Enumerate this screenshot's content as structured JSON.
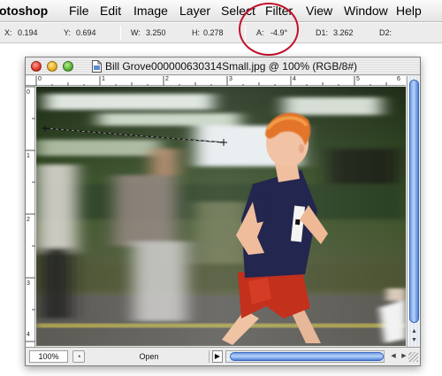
{
  "menubar": {
    "app": "otoshop",
    "items": [
      "File",
      "Edit",
      "Image",
      "Layer",
      "Select",
      "Filter",
      "View",
      "Window",
      "Help"
    ]
  },
  "infobar": {
    "x_label": "X:",
    "x_value": "0.194",
    "y_label": "Y:",
    "y_value": "0.694",
    "w_label": "W:",
    "w_value": "3.250",
    "h_label": "H:",
    "h_value": "0.278",
    "a_label": "A:",
    "a_value": "-4.9°",
    "d1_label": "D1:",
    "d1_value": "3.262",
    "d2_label": "D2:"
  },
  "document": {
    "title": "Bill Grove000000630314Small.jpg @ 100% (RGB/8#)",
    "ruler_top_labels": [
      "0",
      "1",
      "2",
      "3",
      "4",
      "5",
      "6"
    ],
    "ruler_left_labels": [
      "0",
      "1",
      "2",
      "3",
      "4"
    ],
    "zoom": "100%",
    "status_text": "Open",
    "status_arrow": "▶"
  },
  "colors": {
    "highlight": "#c2102a",
    "scroll_thumb": "#6f9de8"
  },
  "icons": {
    "close": "close-button",
    "minimize": "minimize-button",
    "zoom": "zoom-button",
    "document": "document-icon"
  }
}
